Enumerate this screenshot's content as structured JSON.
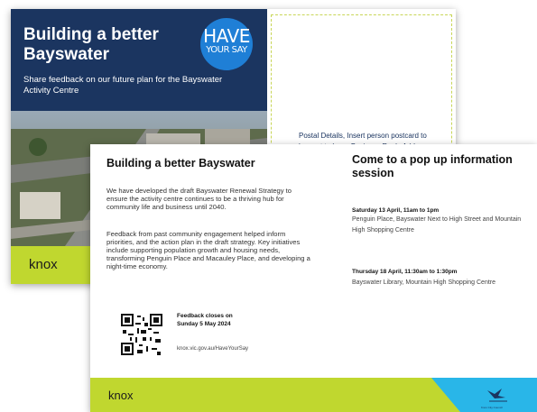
{
  "back_card": {
    "title": "Building a better Bayswater",
    "subtitle": "Share feedback on our future plan for the Bayswater Activity Centre",
    "badge_line1": "HAVE",
    "badge_line2": "YOUR SAY",
    "logo": "knox",
    "postal_text": "Postal Details, Insert person postcard to be sent to here, Business Reply Address"
  },
  "front_card": {
    "title": "Building a better Bayswater",
    "paragraph1": "We have developed the draft Bayswater Renewal Strategy to ensure the activity centre continues to be a thriving hub for community life and business until 2040.",
    "paragraph2": "Feedback from past community engagement helped inform priorities, and the action plan in the draft strategy. Key initiatives include supporting population growth and housing needs, transforming Penguin Place and Macauley Place, and developing a night-time economy.",
    "feedback_closes_line1": "Feedback closes on",
    "feedback_closes_line2": "Sunday 5 May 2024",
    "feedback_url": "knox.vic.gov.au/HaveYourSay",
    "popup_title": "Come to a pop up information session",
    "sessions": [
      {
        "date": "Saturday 13 April, 11am to 1pm",
        "detail": "Penguin Place, Bayswater Next to High Street and Mountain High Shopping Centre"
      },
      {
        "date": "Thursday 18 April, 11:30am to 1:30pm",
        "detail": "Bayswater Library, Mountain High Shopping Centre"
      }
    ],
    "logo": "knox",
    "council_label": "Knox City Council"
  },
  "colors": {
    "navy": "#1b3560",
    "lime": "#c0d72f",
    "badge_blue": "#1f7fd6",
    "corner_cyan": "#29b6e8"
  },
  "icons": [
    "have-your-say-badge",
    "qr-code",
    "knox-council-bird-logo"
  ]
}
